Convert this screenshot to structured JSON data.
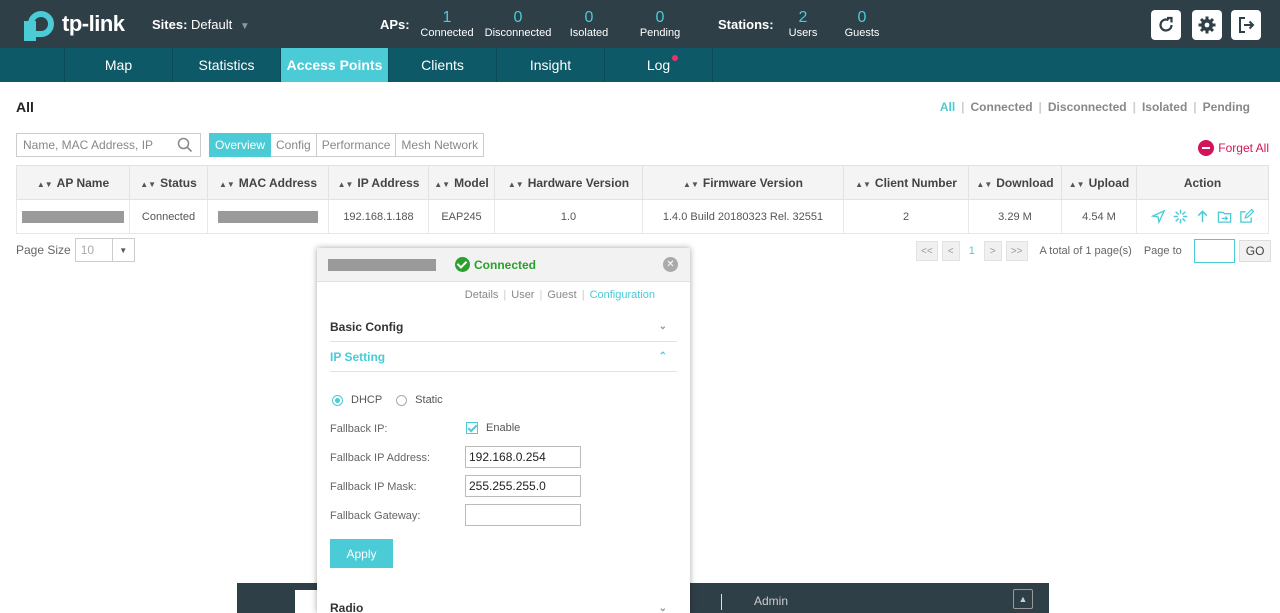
{
  "brand": {
    "name": "tp-link",
    "accent": "#4acbd6"
  },
  "header": {
    "sites_label": "Sites:",
    "site_value": "Default",
    "aps_label": "APs:",
    "aps": [
      {
        "value": "1",
        "label": "Connected"
      },
      {
        "value": "0",
        "label": "Disconnected"
      },
      {
        "value": "0",
        "label": "Isolated"
      },
      {
        "value": "0",
        "label": "Pending"
      }
    ],
    "stations_label": "Stations:",
    "stations": [
      {
        "value": "2",
        "label": "Users"
      },
      {
        "value": "0",
        "label": "Guests"
      }
    ]
  },
  "nav": [
    "Map",
    "Statistics",
    "Access Points",
    "Clients",
    "Insight",
    "Log"
  ],
  "page": {
    "title": "All",
    "filters": [
      "All",
      "Connected",
      "Disconnected",
      "Isolated",
      "Pending"
    ]
  },
  "toolbar": {
    "search_placeholder": "Name, MAC Address, IP",
    "tabs": [
      "Overview",
      "Config",
      "Performance",
      "Mesh Network"
    ],
    "forget_all": "Forget All"
  },
  "table": {
    "columns": [
      "AP Name",
      "Status",
      "MAC Address",
      "IP Address",
      "Model",
      "Hardware Version",
      "Firmware Version",
      "Client Number",
      "Download",
      "Upload",
      "Action"
    ],
    "rows": [
      {
        "status": "Connected",
        "ip": "192.168.1.188",
        "model": "EAP245",
        "hw": "1.0",
        "fw": "1.4.0 Build 20180323 Rel. 32551",
        "clients": "2",
        "download": "3.29 M",
        "upload": "4.54 M"
      }
    ]
  },
  "pagination": {
    "page_size_label": "Page Size",
    "page_size": "10",
    "first": "<<",
    "prev": "<",
    "current": "1",
    "next": ">",
    "last": ">>",
    "total": "A total of 1 page(s)",
    "page_to": "Page to",
    "go": "GO"
  },
  "footer": {
    "user": "Admin"
  },
  "panel": {
    "status": "Connected",
    "tabs": [
      "Details",
      "User",
      "Guest",
      "Configuration"
    ],
    "basic_config": "Basic Config",
    "ip_setting": "IP Setting",
    "dhcp": "DHCP",
    "static": "Static",
    "fallback_ip_label": "Fallback IP:",
    "enable": "Enable",
    "fallback_ip_address_label": "Fallback IP Address:",
    "fallback_ip_address": "192.168.0.254",
    "fallback_ip_mask_label": "Fallback IP Mask:",
    "fallback_ip_mask": "255.255.255.0",
    "fallback_gateway_label": "Fallback Gateway:",
    "fallback_gateway": "",
    "apply": "Apply",
    "radio": "Radio"
  }
}
